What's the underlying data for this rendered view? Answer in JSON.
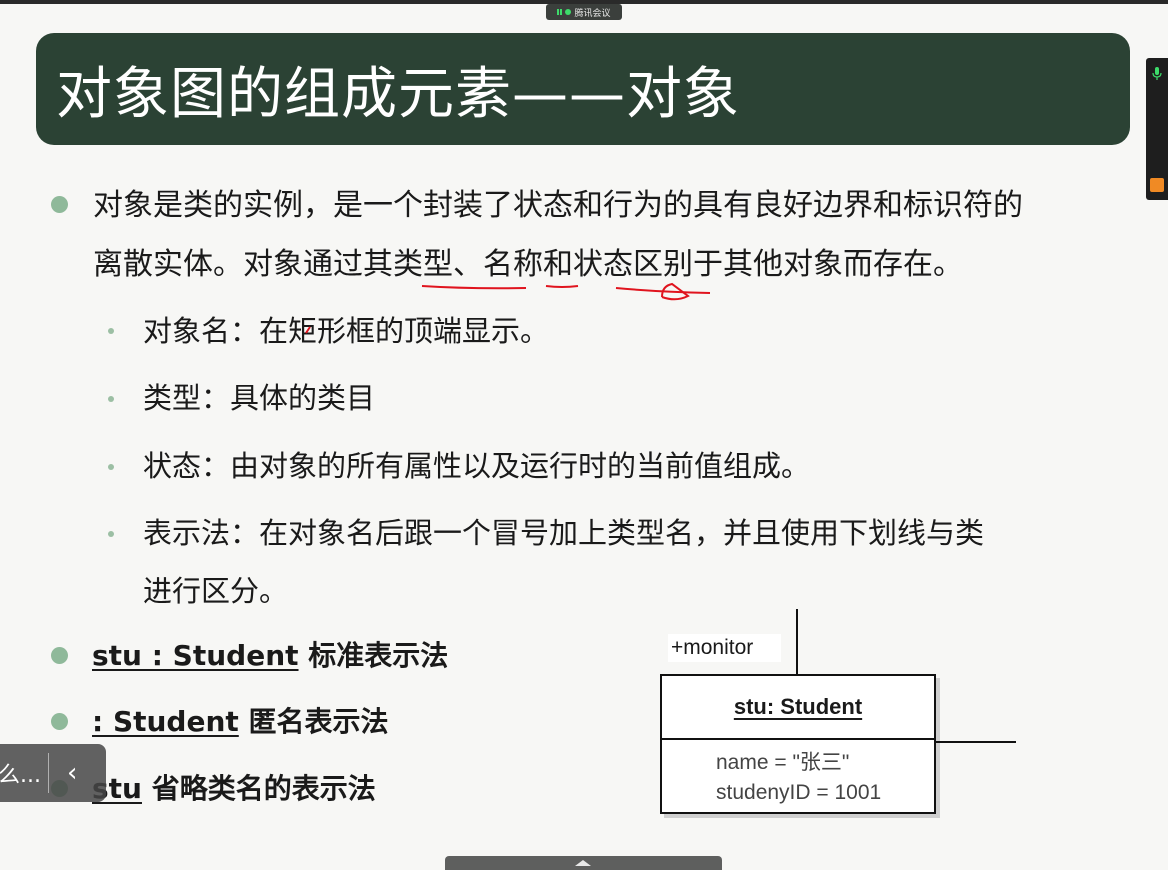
{
  "meeting": {
    "label": "腾讯会议"
  },
  "title": "对象图的组成元素——对象",
  "intro": {
    "line1": "对象是类的实例，是一个封装了状态和行为的具有良好边界和标识符的",
    "line2": "离散实体。对象通过其类型、名称和状态区别于其他对象而存在。"
  },
  "sub_items": [
    {
      "text": "对象名：在矩形框的顶端显示。"
    },
    {
      "text": "类型：具体的类目"
    },
    {
      "text": "状态：由对象的所有属性以及运行时的当前值组成。"
    },
    {
      "text": "表示法：在对象名后跟一个冒号加上类型名，并且使用下划线与类"
    },
    {
      "text": "进行区分。"
    }
  ],
  "notations": [
    {
      "code": "stu : Student",
      "desc": " 标准表示法"
    },
    {
      "code": " : Student",
      "desc": " 匿名表示法"
    },
    {
      "code": "stu",
      "desc": " 省略类名的表示法"
    }
  ],
  "uml": {
    "role": "+monitor",
    "object_name": "stu: Student",
    "attributes": [
      "name = \"张三\"",
      "studenyID = 1001"
    ]
  },
  "overlay": {
    "text": "么...",
    "chevron": "‹"
  },
  "colors": {
    "title_bg": "#2b4234",
    "bullet": "#8fb99a",
    "annotation": "#e0141e"
  }
}
